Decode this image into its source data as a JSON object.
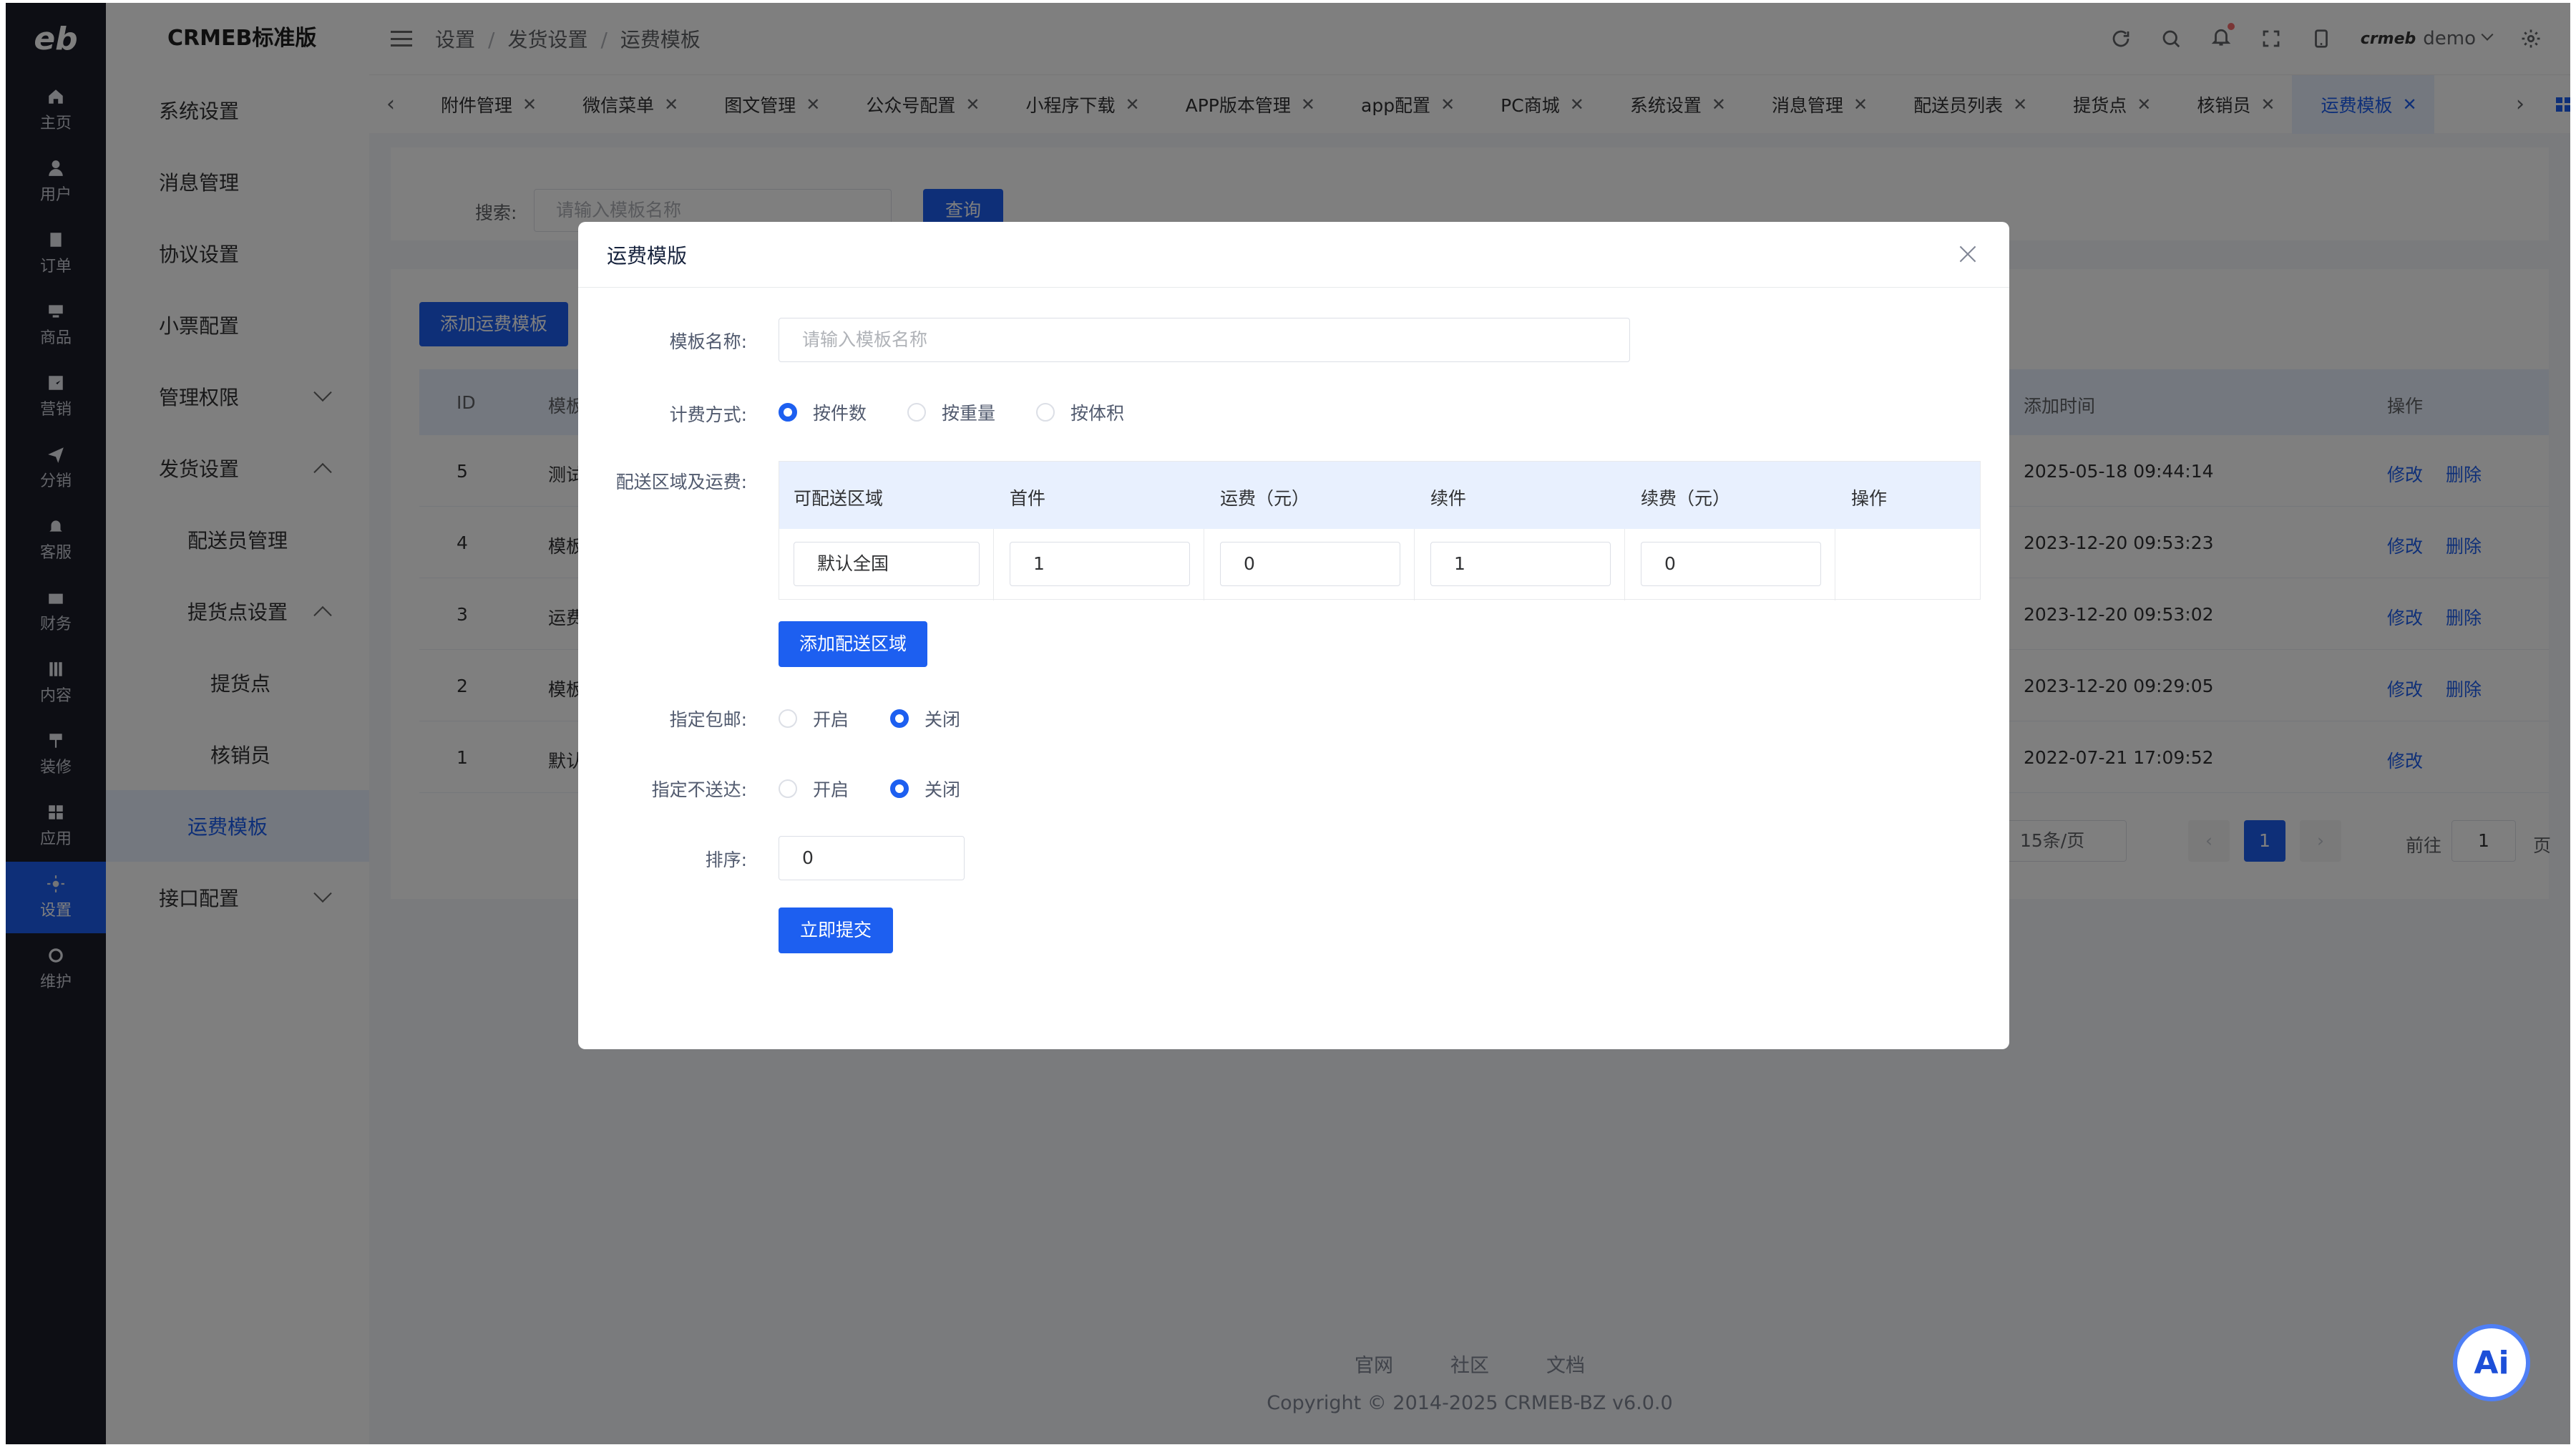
{
  "rail": {
    "logo": "eb",
    "items": [
      {
        "label": "主页",
        "icon": "home-icon"
      },
      {
        "label": "用户",
        "icon": "user-icon"
      },
      {
        "label": "订单",
        "icon": "order-icon"
      },
      {
        "label": "商品",
        "icon": "goods-icon"
      },
      {
        "label": "营销",
        "icon": "marketing-icon"
      },
      {
        "label": "分销",
        "icon": "send-icon"
      },
      {
        "label": "客服",
        "icon": "bell-icon"
      },
      {
        "label": "财务",
        "icon": "wallet-icon"
      },
      {
        "label": "内容",
        "icon": "content-icon"
      },
      {
        "label": "装修",
        "icon": "decor-icon"
      },
      {
        "label": "应用",
        "icon": "apps-icon"
      },
      {
        "label": "设置",
        "icon": "gear-icon"
      },
      {
        "label": "维护",
        "icon": "maintain-icon"
      }
    ],
    "active_index": 11
  },
  "menu": {
    "brand": "CRMEB标准版",
    "items": [
      {
        "label": "系统设置"
      },
      {
        "label": "消息管理"
      },
      {
        "label": "协议设置"
      },
      {
        "label": "小票配置"
      },
      {
        "label": "管理权限"
      },
      {
        "label": "发货设置"
      },
      {
        "label": "配送员管理"
      },
      {
        "label": "提货点设置"
      },
      {
        "label": "提货点"
      },
      {
        "label": "核销员"
      },
      {
        "label": "运费模板"
      },
      {
        "label": "接口配置"
      }
    ]
  },
  "header": {
    "breadcrumb": [
      "设置",
      "发货设置",
      "运费模板"
    ],
    "user_logo": "crmeb",
    "user_name": "demo"
  },
  "tabs": [
    {
      "label": "附件管理"
    },
    {
      "label": "微信菜单"
    },
    {
      "label": "图文管理"
    },
    {
      "label": "公众号配置"
    },
    {
      "label": "小程序下载"
    },
    {
      "label": "APP版本管理"
    },
    {
      "label": "app配置"
    },
    {
      "label": "PC商城"
    },
    {
      "label": "系统设置"
    },
    {
      "label": "消息管理"
    },
    {
      "label": "配送员列表"
    },
    {
      "label": "提货点"
    },
    {
      "label": "核销员"
    },
    {
      "label": "运费模板"
    }
  ],
  "page": {
    "search_label": "搜索:",
    "search_placeholder": "请输入模板名称",
    "search_button": "查询",
    "add_button": "添加运费模板",
    "columns": {
      "id": "ID",
      "name": "模板",
      "added": "添加时间",
      "ops": "操作"
    },
    "rows": [
      {
        "id": "5",
        "name": "测试",
        "added": "2025-05-18 09:44:14",
        "edit": "修改",
        "del": "删除"
      },
      {
        "id": "4",
        "name": "模板",
        "added": "2023-12-20 09:53:23",
        "edit": "修改",
        "del": "删除"
      },
      {
        "id": "3",
        "name": "运费",
        "added": "2023-12-20 09:53:02",
        "edit": "修改",
        "del": "删除"
      },
      {
        "id": "2",
        "name": "模板",
        "added": "2023-12-20 09:29:05",
        "edit": "修改",
        "del": "删除"
      },
      {
        "id": "1",
        "name": "默认",
        "added": "2022-07-21 17:09:52",
        "edit": "修改",
        "del": ""
      }
    ],
    "pager": {
      "size": "15条/页",
      "current": "1",
      "goto_label": "前往",
      "goto_value": "1",
      "page_unit": "页"
    }
  },
  "footer": {
    "links": [
      "官网",
      "社区",
      "文档"
    ],
    "copyright": "Copyright © 2014-2025 CRMEB-BZ v6.0.0"
  },
  "ai_button": "Ai",
  "modal": {
    "title": "运费模版",
    "name_label": "模板名称:",
    "name_placeholder": "请输入模板名称",
    "billing_label": "计费方式:",
    "billing_options": [
      "按件数",
      "按重量",
      "按体积"
    ],
    "billing_selected": "按件数",
    "region_label": "配送区域及运费:",
    "region_columns": [
      "可配送区域",
      "首件",
      "运费（元）",
      "续件",
      "续费（元）",
      "操作"
    ],
    "region_row": {
      "area": "默认全国",
      "first": "1",
      "first_fee": "0",
      "next": "1",
      "next_fee": "0"
    },
    "add_region_button": "添加配送区域",
    "free_label": "指定包邮:",
    "free_options": [
      "开启",
      "关闭"
    ],
    "free_selected": "关闭",
    "nodeliver_label": "指定不送达:",
    "nodeliver_options": [
      "开启",
      "关闭"
    ],
    "nodeliver_selected": "关闭",
    "sort_label": "排序:",
    "sort_value": "0",
    "submit_button": "立即提交"
  },
  "colors": {
    "primary": "#1d5ff0",
    "rail_bg": "#1b1d29",
    "highlight_bg": "#e8f0fe"
  }
}
